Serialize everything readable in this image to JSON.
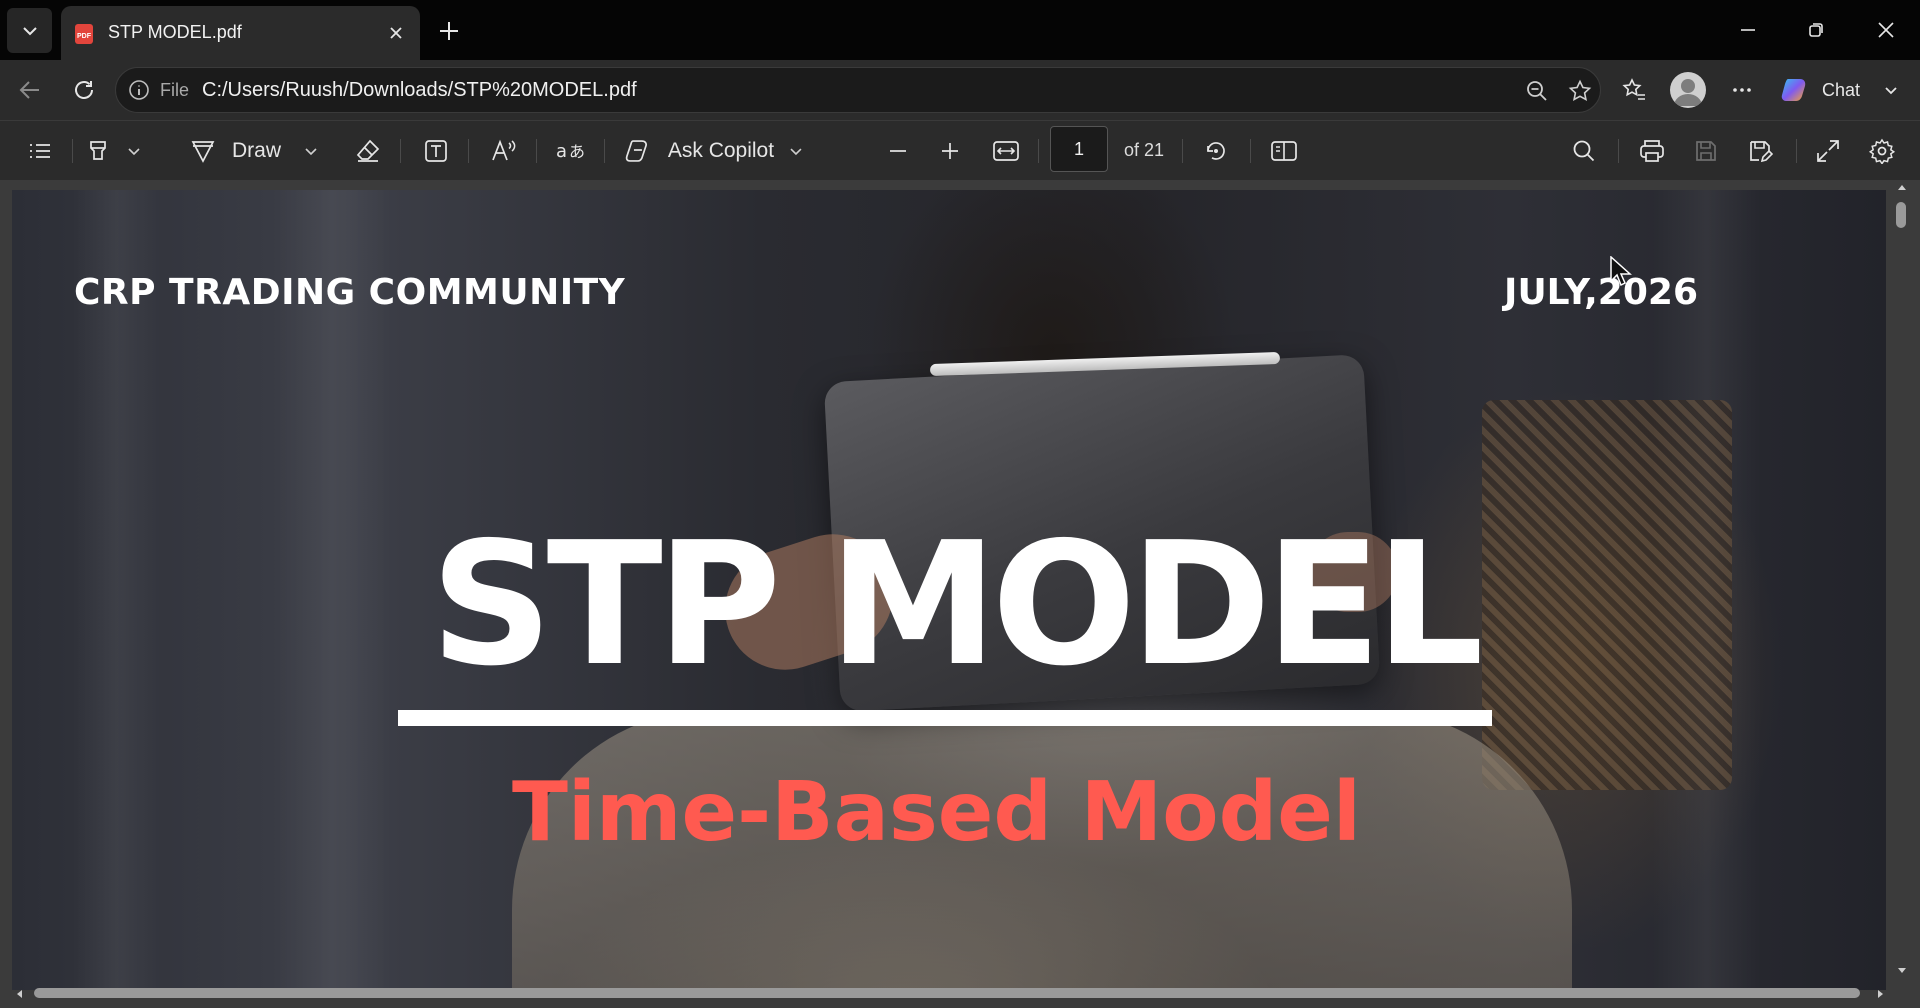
{
  "tab": {
    "title": "STP MODEL.pdf"
  },
  "address": {
    "scheme": "File",
    "url": "C:/Users/Ruush/Downloads/STP%20MODEL.pdf"
  },
  "copilot": {
    "label": "Chat"
  },
  "toolbar": {
    "draw_label": "Draw",
    "ask_copilot_label": "Ask Copilot",
    "page_current": "1",
    "page_total": "of 21"
  },
  "document": {
    "organization": "CRP TRADING COMMUNITY",
    "date": "JULY,2026",
    "title": "STP MODEL",
    "subtitle": "Time-Based Model"
  },
  "colors": {
    "subtitle": "#ff5a50",
    "chrome": "#2b2b2b",
    "tabbar": "#050505"
  },
  "icons": [
    "tab-actions-chevron-icon",
    "pdf-file-icon",
    "close-icon",
    "plus-icon",
    "minimize-icon",
    "restore-icon",
    "window-close-icon",
    "back-arrow-icon",
    "refresh-icon",
    "info-icon",
    "zoom-out-icon",
    "star-icon",
    "favorites-icon",
    "profile-icon",
    "more-icon",
    "copilot-icon",
    "chevron-down-icon",
    "contents-icon",
    "highlight-icon",
    "draw-icon",
    "eraser-icon",
    "text-box-icon",
    "read-aloud-icon",
    "translate-icon",
    "copilot-icon",
    "minus-icon",
    "fit-page-icon",
    "rotate-icon",
    "page-view-icon",
    "search-icon",
    "print-icon",
    "save-icon",
    "save-as-icon",
    "fullscreen-icon",
    "settings-icon"
  ]
}
